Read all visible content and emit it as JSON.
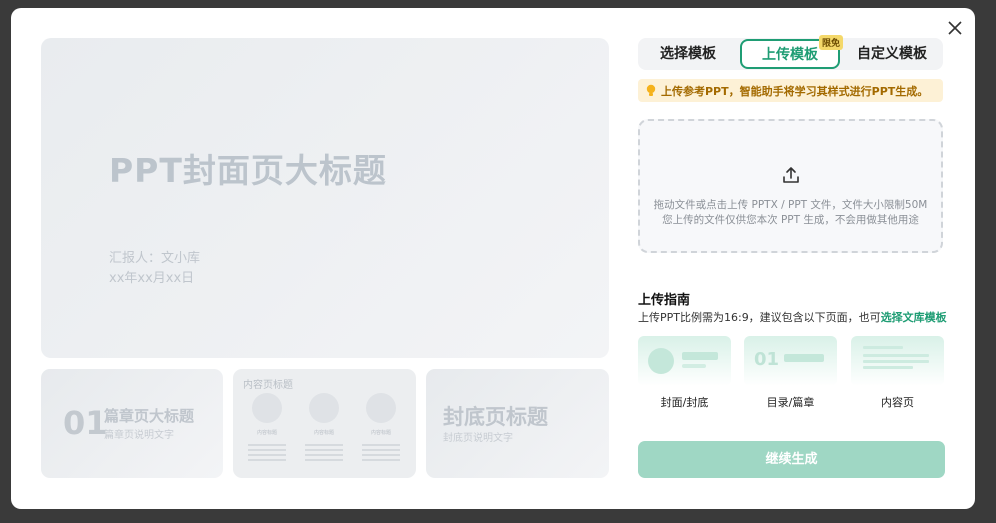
{
  "modal": {
    "preview": {
      "cover_title": "PPT封面页大标题",
      "cover_reporter": "汇报人：文小库",
      "cover_date": "xx年xx月xx日",
      "chapter_num": "01",
      "chapter_title": "篇章页大标题",
      "chapter_sub": "篇章页说明文字",
      "content_title": "内容页标题",
      "content_labels": [
        "内容标题",
        "内容标题",
        "内容标题"
      ],
      "back_title": "封底页标题",
      "back_sub": "封底页说明文字"
    },
    "tabs": [
      {
        "label": "选择模板"
      },
      {
        "label": "上传模板",
        "badge": "限免"
      },
      {
        "label": "自定义模板"
      }
    ],
    "notice": "上传参考PPT，智能助手将学习其样式进行PPT生成。",
    "dropzone": {
      "line1": "拖动文件或点击上传 PPTX / PPT 文件，文件大小限制50M",
      "line2": "您上传的文件仅供您本次 PPT 生成，不会用做其他用途"
    },
    "guide": {
      "title": "上传指南",
      "desc": "上传PPT比例需为16:9，建议包含以下页面，也可",
      "link": "选择文库模板",
      "examples": [
        {
          "label": "封面/封底"
        },
        {
          "label": "目录/篇章",
          "num": "01"
        },
        {
          "label": "内容页"
        }
      ]
    },
    "continue_label": "继续生成"
  },
  "colors": {
    "accent": "#1f9d74",
    "accent_light": "#9fd7c4",
    "notice_bg": "#fdf1d6"
  }
}
